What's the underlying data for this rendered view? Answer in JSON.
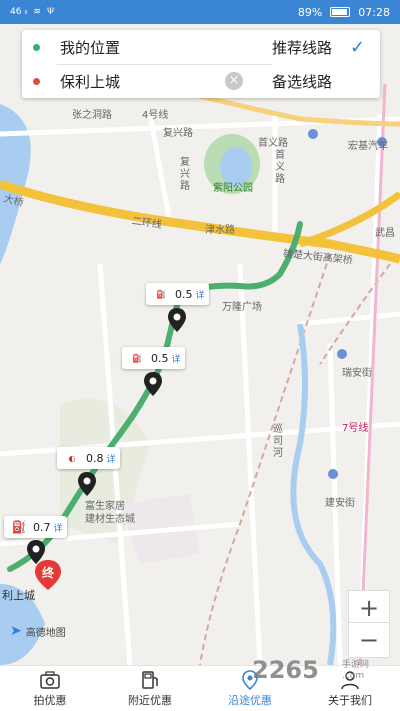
{
  "status": {
    "signal": "46 ᵢₗ",
    "battery": "89%",
    "time": "07:28"
  },
  "search": {
    "origin": "我的位置",
    "destination": "保利上城",
    "recommended_route": "推荐线路",
    "alternate_route": "备选线路"
  },
  "map": {
    "labels": {
      "zhangzhidong_rd": "张之洞路",
      "line4": "4号线",
      "fuxing_rd": "复兴路",
      "fuxing_rd_v": "复\n兴\n路",
      "shouyi_rd": "首义路",
      "shouyi_rd_v": "首\n义\n路",
      "hongji": "宏基汽车",
      "ziyang_park": "紫阳公园",
      "wusheng": "武昌",
      "daqiao": "大桥",
      "second_ring": "二环线",
      "jinshui_rd": "津水路",
      "xiongchu_viaduct": "雄楚大街高架桥",
      "wanlong": "万隆广场",
      "ruian": "瑞安街",
      "xunsi_he": "巡\n司\n河",
      "line7": "7号线",
      "jianan": "建安街",
      "furu": "富生家居\n建材生态城",
      "poly_label": "利上城",
      "end_marker": "终",
      "amap": "高德地图"
    },
    "stations": [
      {
        "brand": "SINOPEC",
        "distance": "0.5",
        "more": "详"
      },
      {
        "brand": "SINOPEC",
        "distance": "0.5",
        "more": "详"
      },
      {
        "brand": "CNPC",
        "distance": "0.8",
        "more": "详"
      },
      {
        "brand": "PUMP",
        "distance": "0.7",
        "more": "详"
      }
    ],
    "zoom_in": "+",
    "zoom_out": "−"
  },
  "tabs": [
    {
      "label": "拍优惠",
      "icon": "camera-icon"
    },
    {
      "label": "附近优惠",
      "icon": "fuel-pump-icon"
    },
    {
      "label": "沿途优惠",
      "icon": "location-pin-icon",
      "active": true
    },
    {
      "label": "关于我们",
      "icon": "user-icon"
    }
  ],
  "watermark": {
    "brand": "2265",
    "sub": "手游网\n.com"
  },
  "colors": {
    "status_bar": "#3a86d4",
    "route": "#4caf6f",
    "active_tab": "#3a86d4",
    "origin_dot": "#2db56b",
    "dest_dot": "#e04b3e"
  }
}
